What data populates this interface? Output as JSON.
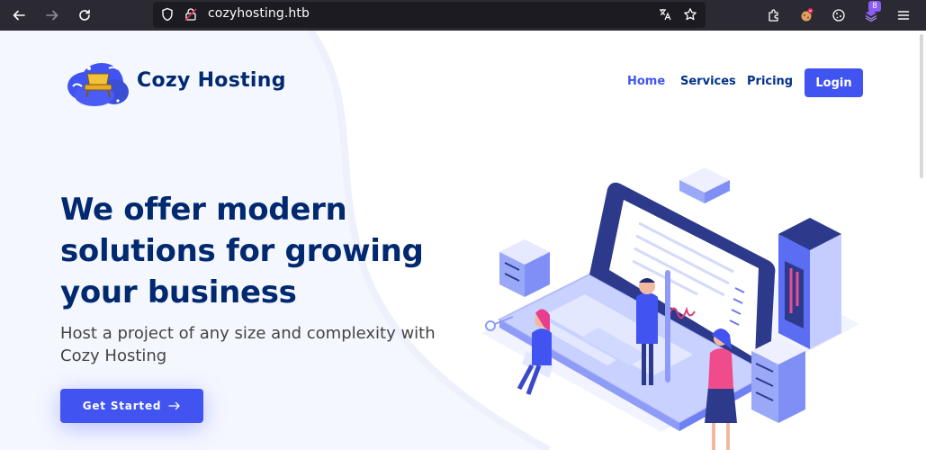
{
  "browser": {
    "url": "cozyhosting.htb",
    "extension_badge": "8"
  },
  "header": {
    "brand": "Cozy Hosting",
    "nav": [
      {
        "label": "Home",
        "active": true
      },
      {
        "label": "Services",
        "active": false
      },
      {
        "label": "Pricing",
        "active": false
      }
    ],
    "login_label": "Login"
  },
  "hero": {
    "title": "We offer modern solutions for growing your business",
    "subtitle": "Host a project of any size and complexity with Cozy Hosting",
    "cta_label": "Get Started",
    "cta_icon": "arrow-right-icon"
  },
  "colors": {
    "primary": "#4154f1",
    "heading": "#012970",
    "chrome": "#2b2a33",
    "urlbar": "#1c1b22"
  }
}
